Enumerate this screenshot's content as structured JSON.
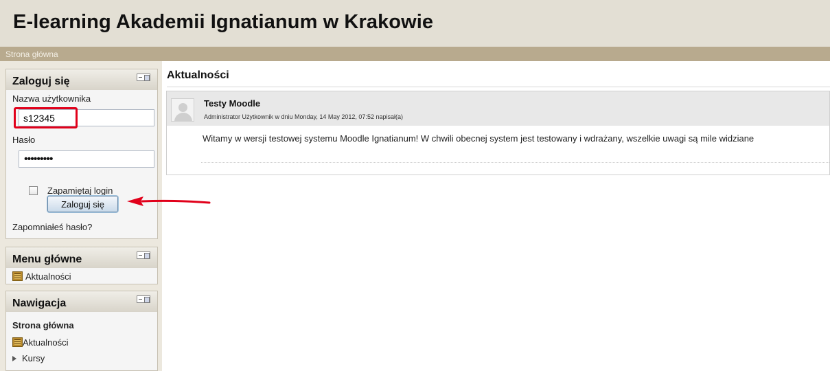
{
  "header": {
    "site_title": "E-learning Akademii Ignatianum w Krakowie"
  },
  "navbar": {
    "home_link": "Strona główna"
  },
  "login_block": {
    "title": "Zaloguj się",
    "username_label": "Nazwa użytkownika",
    "username_value": "s12345",
    "password_label": "Hasło",
    "password_masked": "•••••••••",
    "remember_label": "Zapamiętaj login",
    "remember_checked": false,
    "submit_label": "Zaloguj się",
    "forgot_link": "Zapomniałeś hasło?"
  },
  "menu_block": {
    "title": "Menu główne",
    "items": [
      {
        "label": "Aktualności",
        "icon": "news-forum-icon"
      }
    ]
  },
  "nav_block": {
    "title": "Nawigacja",
    "home": "Strona główna",
    "items": [
      {
        "label": "Aktualności",
        "icon": "news-forum-icon"
      },
      {
        "label": "Kursy",
        "icon": "expand-triangle-icon"
      }
    ]
  },
  "main": {
    "section_title": "Aktualności",
    "post": {
      "subject": "Testy Moodle",
      "author_line": "Administrator Użytkownik w dniu Monday, 14 May 2012, 07:52 napisał(a)",
      "body": "Witamy w wersji testowej systemu Moodle Ignatianum! W chwili obecnej system jest testowany i wdrażany, wszelkie uwagi są mile widziane"
    }
  },
  "annotations": {
    "highlight_color": "#e1001a",
    "arrow_color": "#e1001a"
  }
}
